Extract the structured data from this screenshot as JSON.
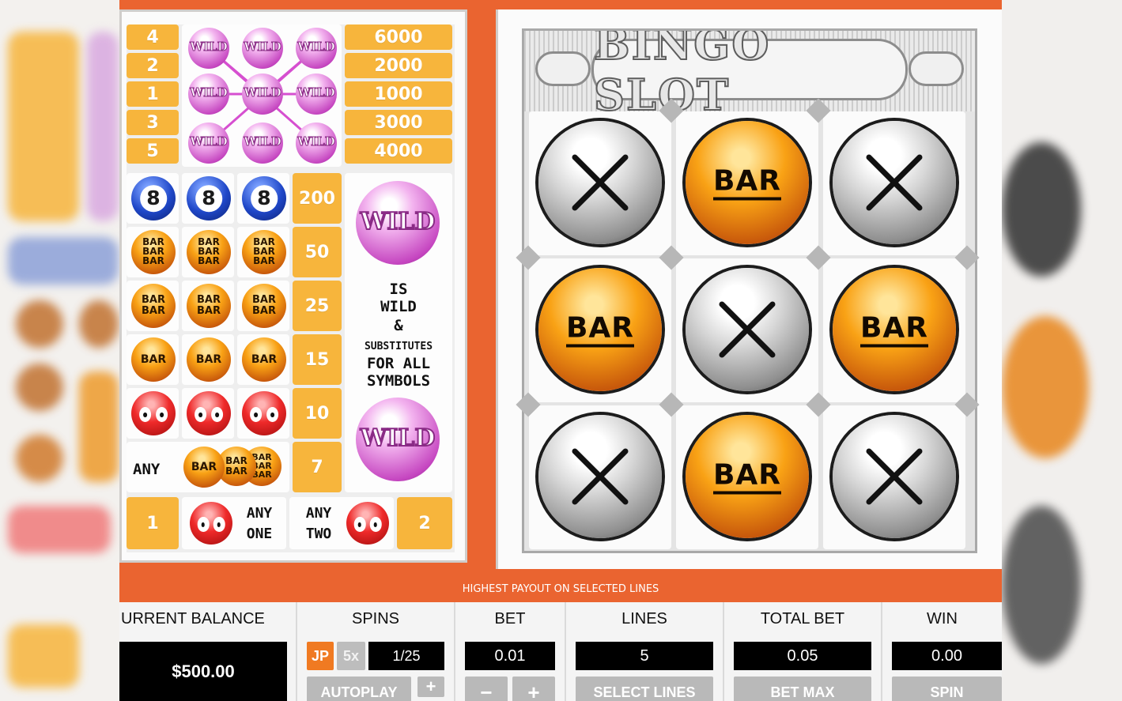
{
  "paytable": {
    "wild_lines": [
      {
        "num": "4",
        "prize": "6000"
      },
      {
        "num": "2",
        "prize": "2000"
      },
      {
        "num": "1",
        "prize": "1000"
      },
      {
        "num": "3",
        "prize": "3000"
      },
      {
        "num": "5",
        "prize": "4000"
      }
    ],
    "wild_symbol_text": "WILD",
    "combos": [
      {
        "symbol": "eight-ball",
        "glyph": "8",
        "payout": "200"
      },
      {
        "symbol": "triple-bar",
        "glyph": "BAR",
        "payout": "50"
      },
      {
        "symbol": "double-bar",
        "glyph": "BAR",
        "payout": "25"
      },
      {
        "symbol": "single-bar",
        "glyph": "BAR",
        "payout": "15"
      },
      {
        "symbol": "red-face",
        "glyph": "",
        "payout": "10"
      }
    ],
    "any_bar": {
      "label": "ANY",
      "glyph": "BAR",
      "payout": "7"
    },
    "red_rule": {
      "left_num": "1",
      "any_one_1": "ANY",
      "any_one_2": "ONE",
      "any_two_1": "ANY",
      "any_two_2": "TWO",
      "right_num": "2"
    },
    "wild_info": {
      "line1": "IS",
      "line2": "WILD",
      "line3": "&",
      "line4": "SUBSTITUTES",
      "line5": "FOR ALL",
      "line6": "SYMBOLS"
    }
  },
  "game": {
    "title": "BINGO SLOT",
    "reels": [
      [
        "x-ball",
        "bar-ball",
        "x-ball"
      ],
      [
        "bar-ball",
        "x-ball",
        "bar-ball"
      ],
      [
        "x-ball",
        "bar-ball",
        "x-ball"
      ]
    ],
    "bar_label": "BAR"
  },
  "notice": "HIGHEST PAYOUT ON SELECTED LINES",
  "controls": {
    "balance_label": "URRENT BALANCE",
    "balance_value": "$500.00",
    "spins_label": "SPINS",
    "jp_label": "JP",
    "five_x_label": "5x",
    "spins_value": "1/25",
    "autoplay_label": "AUTOPLAY",
    "plus_label": "+",
    "bet_label": "BET",
    "bet_value": "0.01",
    "minus_label": "−",
    "bet_plus_label": "+",
    "lines_label": "LINES",
    "lines_value": "5",
    "select_lines_label": "SELECT LINES",
    "total_bet_label": "TOTAL BET",
    "total_bet_value": "0.05",
    "bet_max_label": "BET MAX",
    "win_label": "WIN",
    "win_value": "0.00",
    "spin_label": "SPIN"
  },
  "colors": {
    "accent_orange": "#ea6430",
    "paytable_number": "#f7b53c",
    "wild_pink": "#c545c0",
    "jp_badge": "#f07a22"
  }
}
